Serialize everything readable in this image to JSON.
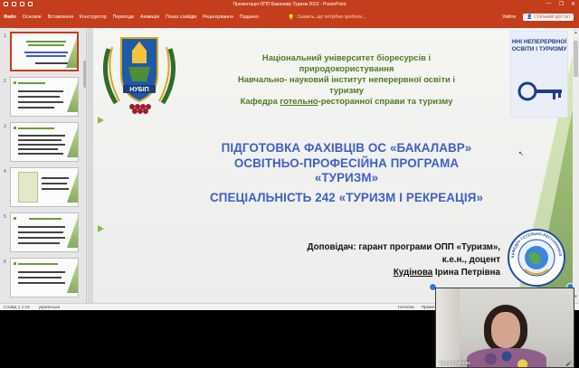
{
  "window": {
    "title": "Презентація ОПП  Бакалавр Туризм 2023 - PowerPoint",
    "controls": [
      "—",
      "❐",
      "✕"
    ]
  },
  "ribbon": {
    "tabs": [
      "Файл",
      "Основне",
      "Вставлення",
      "Конструктор",
      "Переходи",
      "Анімація",
      "Показ слайдів",
      "Рецензування",
      "Подання"
    ],
    "search_placeholder": "Скажіть, що потрібно зробити...",
    "signin": "Увійти",
    "share": "Спільний доступ"
  },
  "thumbnails": [
    {
      "num": "1",
      "selected": true
    },
    {
      "num": "2",
      "selected": false
    },
    {
      "num": "3",
      "selected": false
    },
    {
      "num": "4",
      "selected": false
    },
    {
      "num": "5",
      "selected": false
    },
    {
      "num": "6",
      "selected": false
    }
  ],
  "slide": {
    "logo_left_text": "НУБІП",
    "logo_right_text": "ННІ НЕПЕРЕРВНОЇ ОСВІТИ І ТУРИЗМУ",
    "institution": {
      "line1": "Національний університет біоресурсів і",
      "line2": "природокористування",
      "line3": "Навчально- науковий інститут неперервної освіти і",
      "line4": "туризму",
      "line5a": "Кафедра ",
      "line5u": "готельно",
      "line5b": "-ресторанної справи та туризму"
    },
    "title": {
      "line1": "ПІДГОТОВКА ФАХІВЦІВ ОС «БАКАЛАВР»",
      "line2": "ОСВІТНЬО-ПРОФЕСІЙНА ПРОГРАМА",
      "line3": "«ТУРИЗМ»",
      "line4": "СПЕЦІАЛЬНІСТЬ 242 «ТУРИЗМ І РЕКРЕАЦІЯ»"
    },
    "speaker": {
      "line1": "Доповідач: гарант програми ОПП «Туризм»,",
      "line2": "к.е.н., доцент",
      "name": "Кудінова",
      "name_rest": " Ірина Петрівна"
    },
    "stamp_text": "КАФЕДРА ГОТЕЛЬНО-РЕСТОРАННОЇ СПРАВИ ТА ТУРИЗМУ"
  },
  "statusbar": {
    "slide_count": "Слайд 1 з 10",
    "language": "українська",
    "notes": "Нотатки",
    "comments": "Примітки"
  },
  "video": {
    "participant_name": "Ірина  Кудінова"
  },
  "colors": {
    "accent": "#c43e1c",
    "title_blue": "#3e5fc8",
    "institution_green": "#4d7a26"
  }
}
